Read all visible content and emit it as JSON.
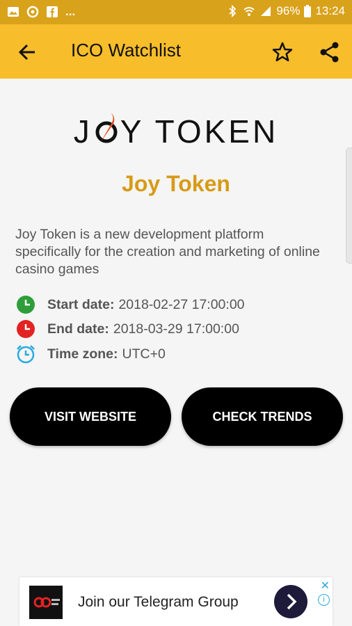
{
  "status_bar": {
    "more": "...",
    "battery": "96%",
    "time": "13:24"
  },
  "app_bar": {
    "title": "ICO Watchlist"
  },
  "logo": {
    "part1": "J",
    "part2": "Y TOKEN"
  },
  "token": {
    "name": "Joy Token",
    "description": "Joy Token is a new development platform specifically for the creation and marketing of online casino games",
    "start_label": "Start date:",
    "start_value": "2018-02-27 17:00:00",
    "end_label": "End date:",
    "end_value": "2018-03-29 17:00:00",
    "tz_label": "Time zone:",
    "tz_value": "UTC+0"
  },
  "buttons": {
    "visit": "VISIT WEBSITE",
    "trends": "CHECK TRENDS"
  },
  "ad": {
    "text": "Join our Telegram Group",
    "close": "✕",
    "info": "i"
  },
  "colors": {
    "app_bar": "#f7bd2b",
    "status_bar": "#d9a21b",
    "token_name": "#d79b17",
    "start_icon": "#2e9e3a",
    "end_icon": "#e32222",
    "tz_icon": "#2aa9e0"
  }
}
